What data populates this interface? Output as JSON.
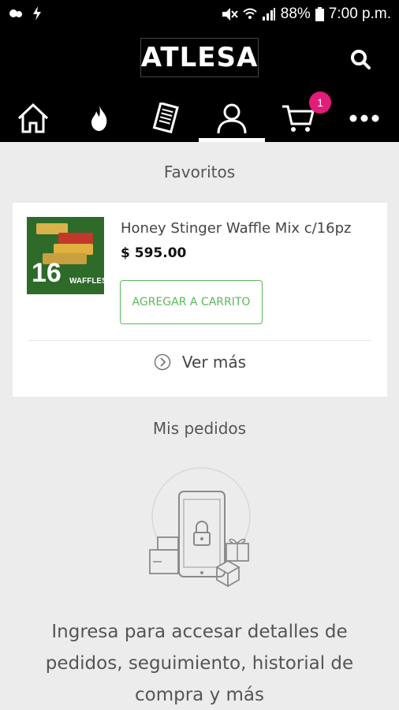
{
  "status_bar": {
    "battery": "88%",
    "time": "7:00 p.m."
  },
  "app": {
    "logo": "ATLESA"
  },
  "nav": {
    "cart_count": "1"
  },
  "favorites": {
    "title": "Favoritos",
    "product": {
      "name": "Honey Stinger Waffle Mix c/16pz",
      "price": "$ 595.00",
      "thumb_number": "16",
      "thumb_label": "WAFFLES"
    },
    "add_button": "AGREGAR A CARRITO",
    "more": "Ver más"
  },
  "orders": {
    "title": "Mis pedidos",
    "message": "Ingresa para accesar detalles de pedidos, seguimiento, historial de compra y más"
  },
  "colors": {
    "accent_green": "#5cb85c",
    "badge_pink": "#e21c7a",
    "bar_black": "#000000"
  }
}
